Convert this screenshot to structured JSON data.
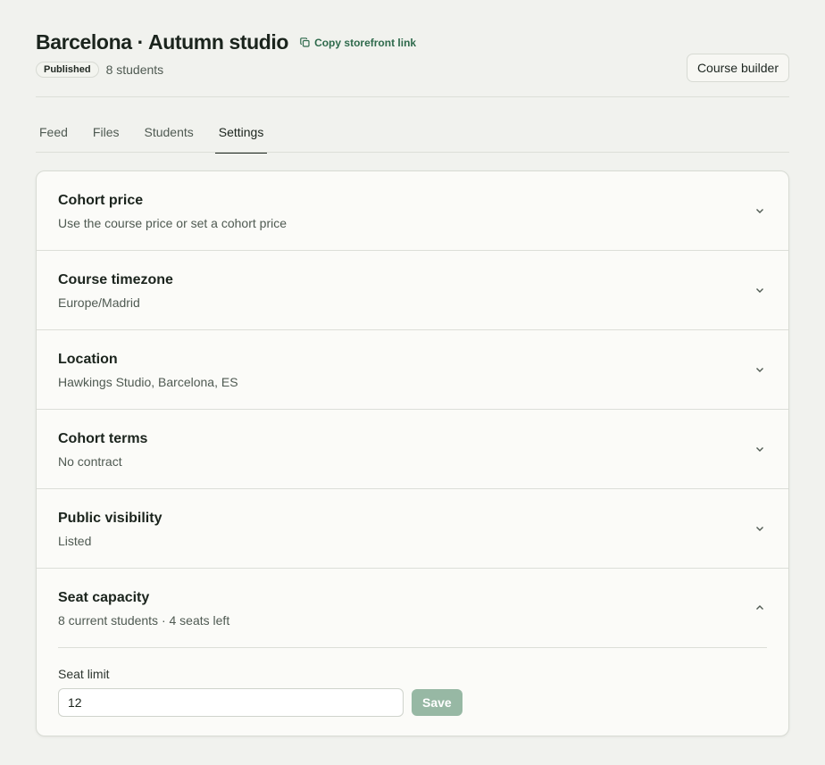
{
  "header": {
    "title": "Barcelona · Autumn studio",
    "copy_link_label": "Copy storefront link",
    "status_badge": "Published",
    "students_count": "8 students",
    "course_builder_label": "Course builder"
  },
  "tabs": [
    {
      "label": "Feed",
      "active": false
    },
    {
      "label": "Files",
      "active": false
    },
    {
      "label": "Students",
      "active": false
    },
    {
      "label": "Settings",
      "active": true
    }
  ],
  "settings": {
    "sections": [
      {
        "title": "Cohort price",
        "subtitle": "Use the course price or set a cohort price",
        "expanded": false
      },
      {
        "title": "Course timezone",
        "subtitle": "Europe/Madrid",
        "expanded": false
      },
      {
        "title": "Location",
        "subtitle": "Hawkings Studio, Barcelona, ES",
        "expanded": false
      },
      {
        "title": "Cohort terms",
        "subtitle": "No contract",
        "expanded": false
      },
      {
        "title": "Public visibility",
        "subtitle": "Listed",
        "expanded": false
      },
      {
        "title": "Seat capacity",
        "subtitle": "8 current students · 4 seats left",
        "expanded": true
      }
    ],
    "seat_limit": {
      "label": "Seat limit",
      "value": "12",
      "save_label": "Save"
    }
  },
  "colors": {
    "accent": "#2f6a4c",
    "save_button": "#97b8a4",
    "background": "#f1f2ee"
  },
  "icons": {
    "copy": "copy-icon",
    "collapsed": "chevron-down-icon",
    "expanded": "chevron-up-icon"
  }
}
